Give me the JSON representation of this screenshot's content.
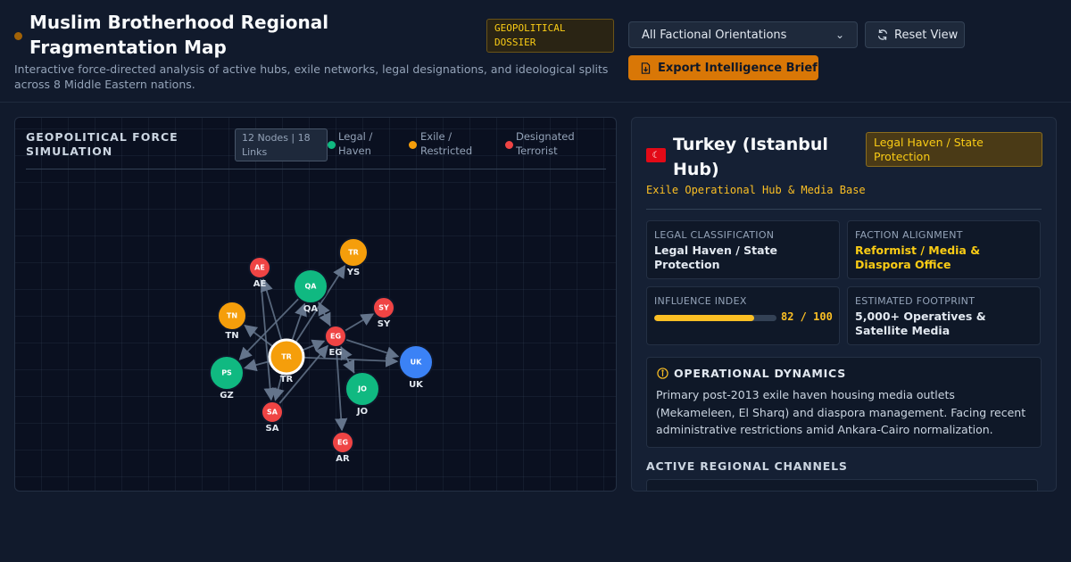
{
  "header": {
    "title": "Muslim Brotherhood Regional Fragmentation Map",
    "badge": "GEOPOLITICAL DOSSIER",
    "subtitle": "Interactive force-directed analysis of active hubs, exile networks, legal designations, and ideological splits across 8 Middle Eastern nations.",
    "filter_value": "All Factional Orientations",
    "reset_label": "Reset View",
    "export_label": "Export Intelligence Brief"
  },
  "simulation": {
    "title": "GEOPOLITICAL FORCE SIMULATION",
    "count_badge": "12 Nodes | 18 Links",
    "legend": [
      {
        "label": "Legal / Haven",
        "color": "#10b981"
      },
      {
        "label": "Exile / Restricted",
        "color": "#f59e0b"
      },
      {
        "label": "Designated Terrorist",
        "color": "#ef4444"
      }
    ]
  },
  "graph": {
    "nodes": [
      {
        "id": "AE",
        "label": "AE",
        "category": "designated",
        "color": "#ef4444",
        "flag": "AE",
        "size": "small"
      },
      {
        "id": "YS",
        "label": "YS",
        "category": "exile",
        "color": "#f59e0b",
        "flag": "TR",
        "size": "medium"
      },
      {
        "id": "QA",
        "label": "QA",
        "category": "legal",
        "color": "#10b981",
        "flag": "QA",
        "size": "large"
      },
      {
        "id": "SY",
        "label": "SY",
        "category": "designated",
        "color": "#ef4444",
        "flag": "SY",
        "size": "small"
      },
      {
        "id": "TN",
        "label": "TN",
        "category": "exile",
        "color": "#f59e0b",
        "flag": "TN",
        "size": "medium"
      },
      {
        "id": "EG",
        "label": "EG",
        "category": "designated",
        "color": "#ef4444",
        "flag": "EG",
        "size": "small"
      },
      {
        "id": "GZ",
        "label": "GZ",
        "category": "legal",
        "color": "#10b981",
        "flag": "PS",
        "size": "large"
      },
      {
        "id": "TR",
        "label": "TR",
        "category": "exile",
        "color": "#f59e0b",
        "flag": "TR",
        "size": "large",
        "selected": true
      },
      {
        "id": "UK",
        "label": "UK",
        "category": "other",
        "color": "#3b82f6",
        "flag": "UK",
        "size": "large"
      },
      {
        "id": "JO",
        "label": "JO",
        "category": "legal",
        "color": "#10b981",
        "flag": "JO",
        "size": "large"
      },
      {
        "id": "SA",
        "label": "SA",
        "category": "designated",
        "color": "#ef4444",
        "flag": "SA",
        "size": "small"
      },
      {
        "id": "AR",
        "label": "AR",
        "category": "designated",
        "color": "#ef4444",
        "flag": "EG",
        "size": "small"
      }
    ],
    "links": [
      [
        "TR",
        "AE"
      ],
      [
        "TR",
        "QA"
      ],
      [
        "TR",
        "YS"
      ],
      [
        "TR",
        "EG"
      ],
      [
        "TR",
        "GZ"
      ],
      [
        "TR",
        "UK"
      ],
      [
        "TR",
        "SA"
      ],
      [
        "TR",
        "TN"
      ],
      [
        "QA",
        "EG"
      ],
      [
        "QA",
        "GZ"
      ],
      [
        "EG",
        "SY"
      ],
      [
        "EG",
        "UK"
      ],
      [
        "EG",
        "AR"
      ],
      [
        "EG",
        "JO"
      ],
      [
        "EG",
        "QA"
      ],
      [
        "AE",
        "SA"
      ],
      [
        "JO",
        "EG"
      ],
      [
        "SA",
        "EG"
      ]
    ]
  },
  "dossier": {
    "flag": "TR",
    "name": "Turkey (Istanbul Hub)",
    "legal_badge": "Legal Haven / State Protection",
    "role": "Exile Operational Hub & Media Base",
    "cards": {
      "legal_label": "LEGAL CLASSIFICATION",
      "legal_value": "Legal Haven / State Protection",
      "faction_label": "FACTION ALIGNMENT",
      "faction_value": "Reformist / Media & Diaspora Office",
      "influence_label": "INFLUENCE INDEX",
      "influence_value": 82,
      "influence_text": "82 / 100",
      "footprint_label": "ESTIMATED FOOTPRINT",
      "footprint_value": "5,000+ Operatives & Satellite Media"
    },
    "ops_title": "OPERATIONAL DYNAMICS",
    "ops_text": "Primary post-2013 exile haven housing media outlets (Mekameleen, El Sharq) and diaspora management. Facing recent administrative restrictions amid Ankara-Cairo normalization.",
    "channels_title": "ACTIVE REGIONAL CHANNELS"
  }
}
